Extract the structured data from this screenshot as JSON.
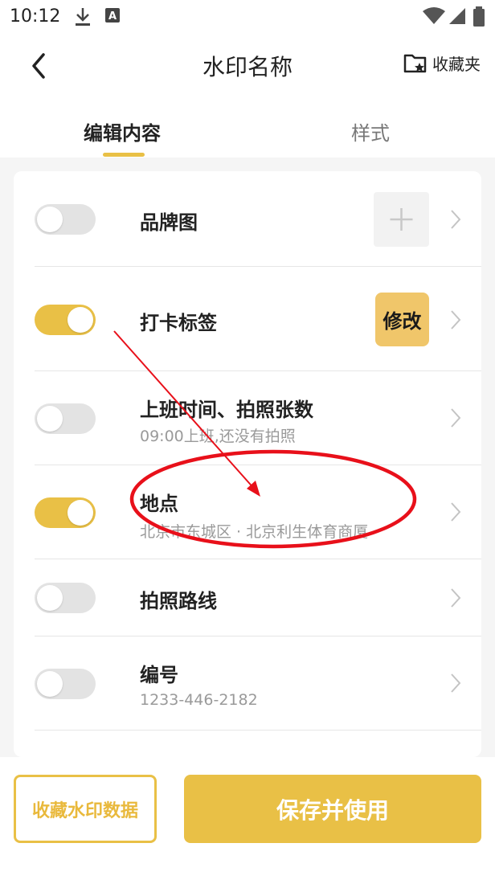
{
  "status_bar": {
    "time": "10:12"
  },
  "header": {
    "title": "水印名称",
    "favorites_label": "收藏夹"
  },
  "tabs": [
    {
      "label": "编辑内容",
      "active": true
    },
    {
      "label": "样式",
      "active": false
    }
  ],
  "rows": [
    {
      "label": "品牌图",
      "enabled": false
    },
    {
      "label": "打卡标签",
      "enabled": true,
      "action_label": "修改"
    },
    {
      "label": "上班时间、拍照张数",
      "subtitle": "09:00上班,还没有拍照",
      "enabled": false
    },
    {
      "label": "地点",
      "subtitle": "北京市东城区 · 北京利生体育商厦",
      "enabled": true
    },
    {
      "label": "拍照路线",
      "enabled": false
    },
    {
      "label": "编号",
      "subtitle": "1233-446-2182",
      "enabled": false
    }
  ],
  "footer": {
    "collect_label": "收藏水印数据",
    "save_label": "保存并使用"
  },
  "colors": {
    "accent": "#e9c046",
    "modify_button": "#f0c66a",
    "annotation_red": "#e8101a"
  },
  "icons": {
    "back": "chevron-left-icon",
    "favorites": "folder-star-icon",
    "add": "plus-icon",
    "row_arrow": "chevron-right-icon"
  }
}
